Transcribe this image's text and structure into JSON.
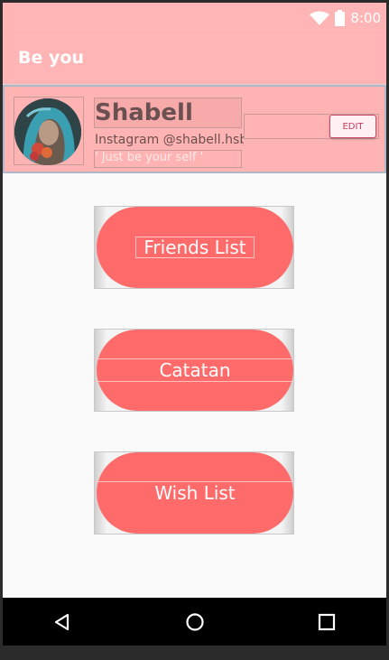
{
  "status_bar": {
    "time": "8:00",
    "icons": [
      "wifi-icon",
      "battery-icon"
    ]
  },
  "app_bar": {
    "title": "Be you"
  },
  "profile": {
    "name": "Shabell",
    "instagram": "Instagram @shabell.hsb",
    "quote": "' Just be your self '",
    "edit_label": "EDIT"
  },
  "menu": [
    {
      "label": "Friends List"
    },
    {
      "label": "Catatan"
    },
    {
      "label": "Wish List"
    }
  ],
  "nav": [
    "back-icon",
    "home-icon",
    "recents-icon"
  ],
  "colors": {
    "primary": "#ffb5b5",
    "button": "#ff6b6b",
    "accent": "#cc3a5a"
  }
}
